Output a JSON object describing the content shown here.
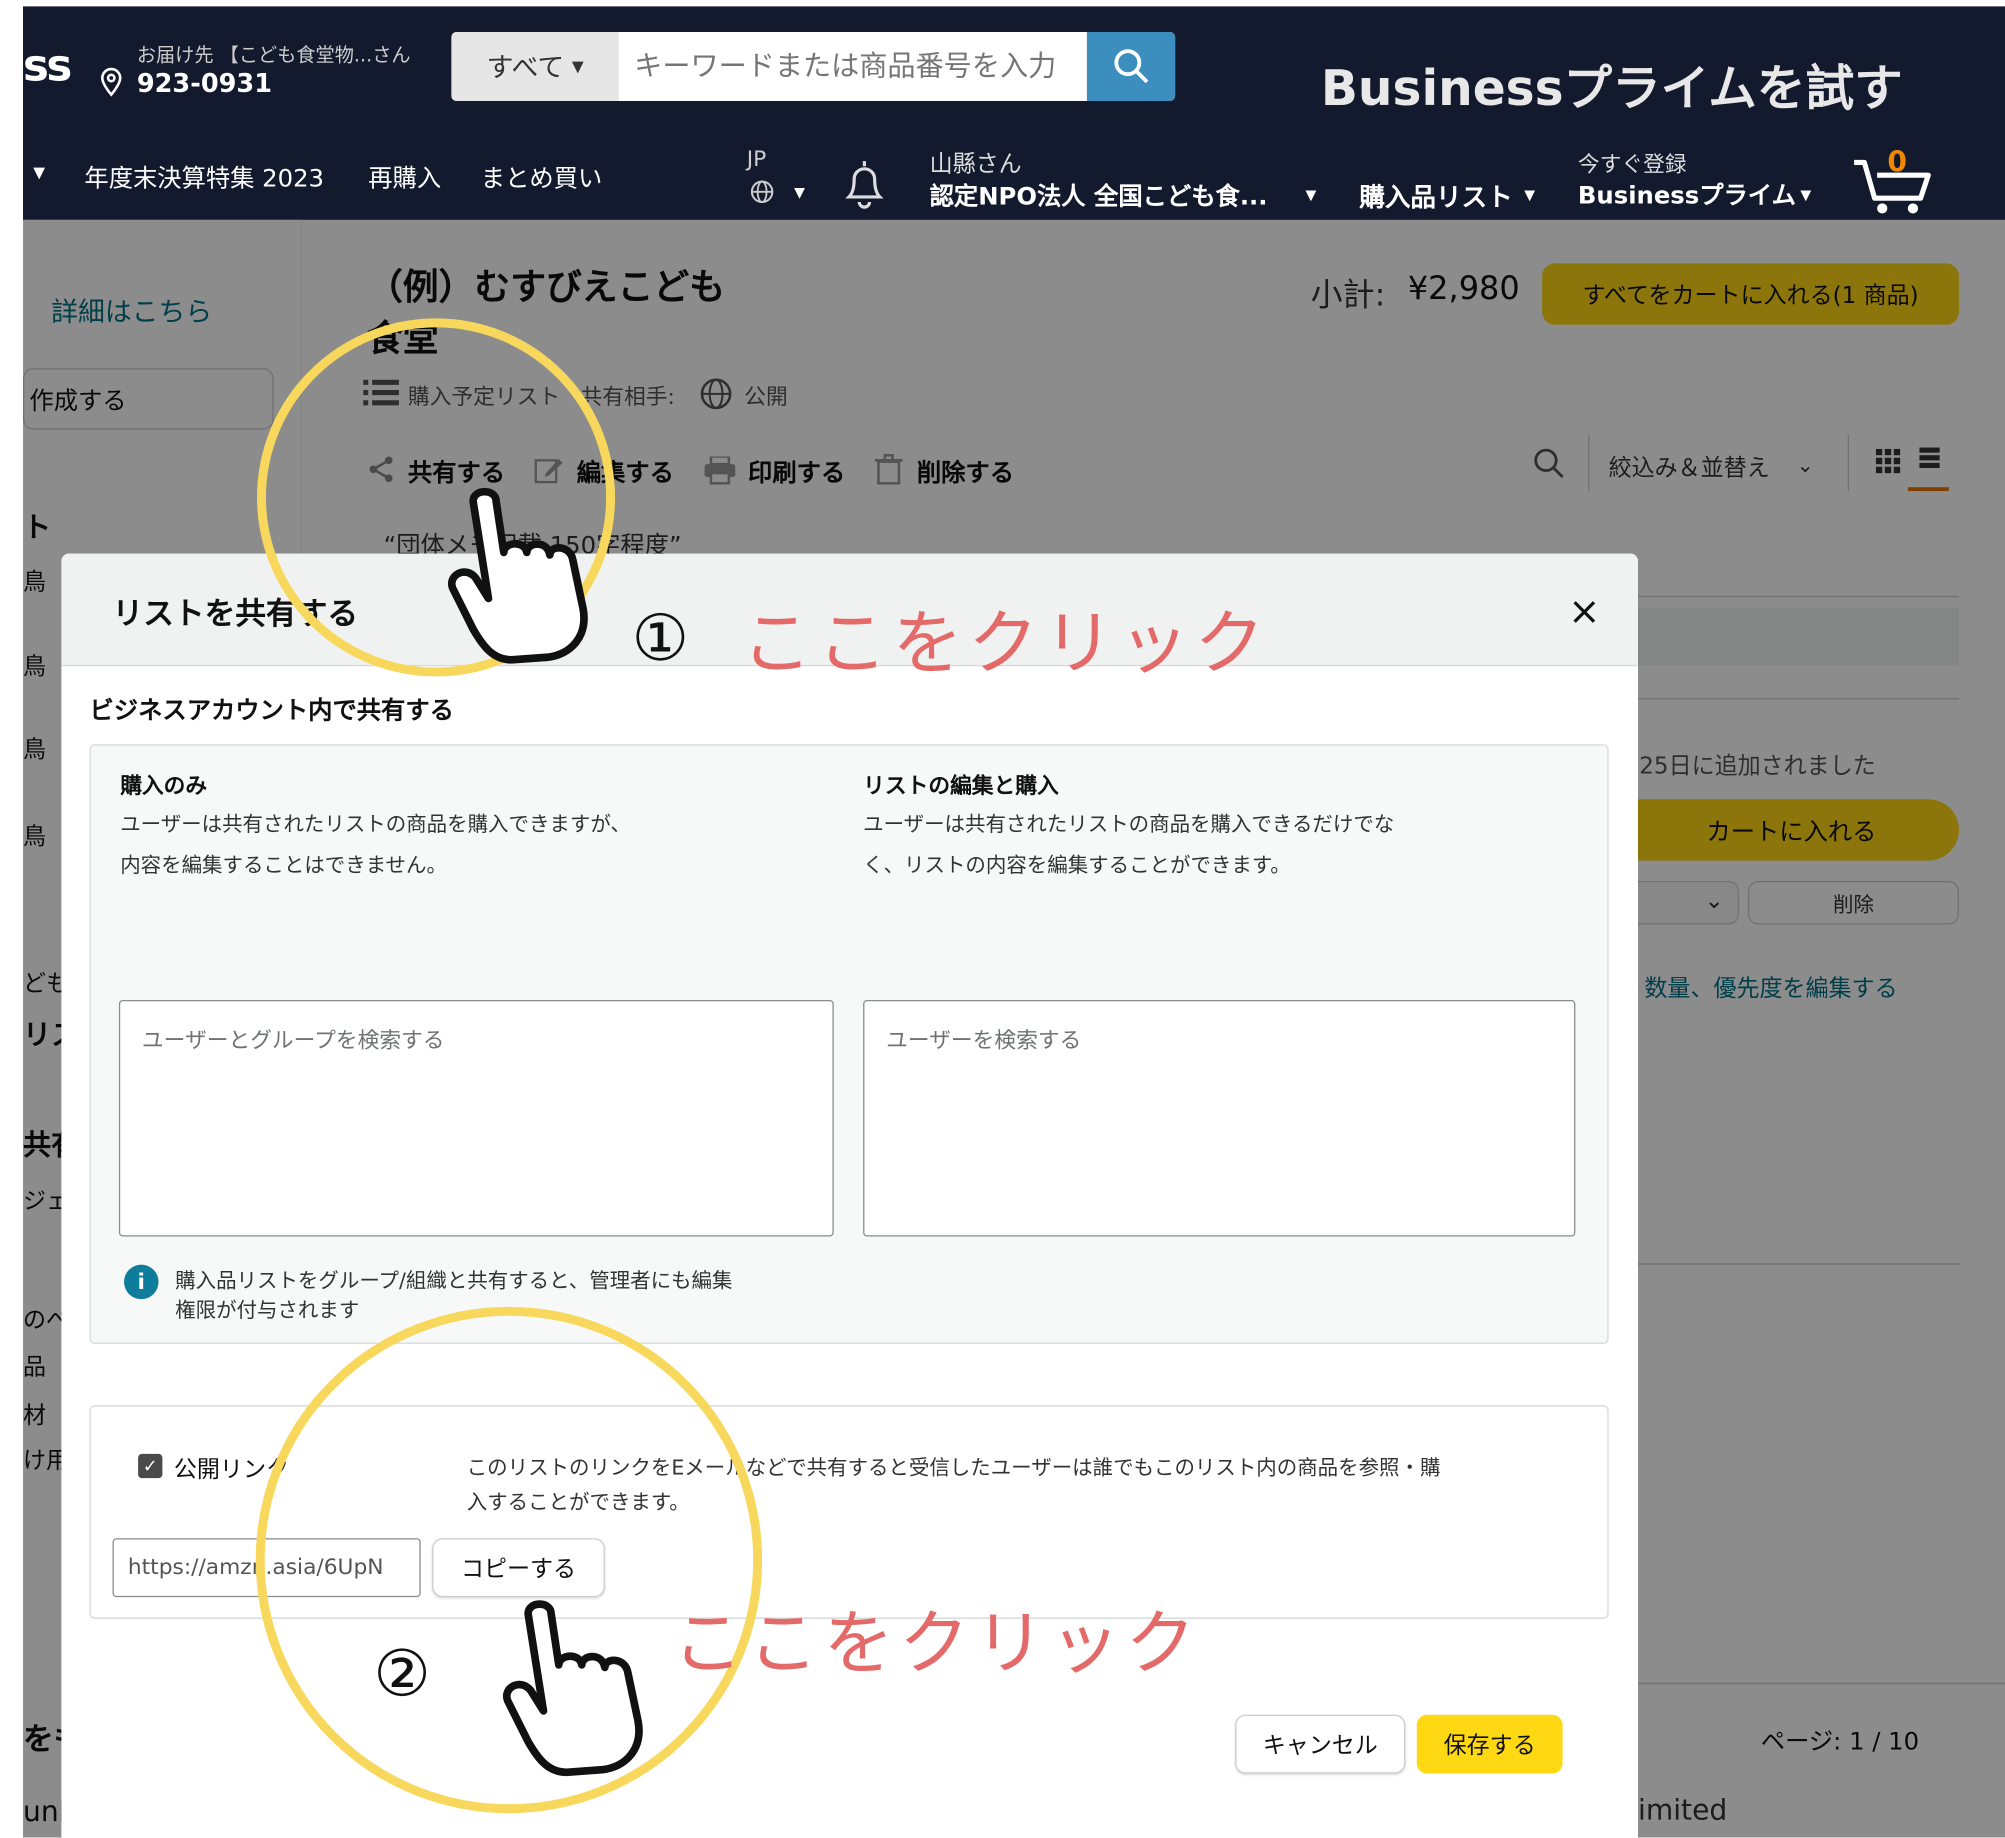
{
  "header": {
    "logo_fragment": "ss",
    "deliver_label": "お届け先 【こども食堂物...さん",
    "postal_code": "923-0931",
    "search_category": "すべて",
    "search_placeholder": "キーワードまたは商品番号を入力",
    "business_prime": "Businessプライムを試す"
  },
  "nav": {
    "items": [
      "年度末決算特集 2023",
      "再購入",
      "まとめ買い"
    ],
    "lang": "JP",
    "account_greeting": "山縣さん",
    "account_name": "認定NPO法人 全国こども食...",
    "lists": "購入品リスト",
    "prime_top": "今すぐ登録",
    "prime_bottom": "Businessプライム",
    "cart_count": "0"
  },
  "sidebar": {
    "details_link": "詳細はこちら",
    "create_button": "作成する",
    "fragments": [
      "ト",
      "鳥",
      "鳥",
      "鳥",
      "鳥",
      "ども",
      "リス",
      "共有",
      "ジェ",
      "のぺ",
      "品",
      "材",
      "け用",
      "をも",
      "unl"
    ]
  },
  "list": {
    "title": "（例）むすびえこども食堂",
    "subtotal_label": "小計:",
    "subtotal_value": "¥2,980",
    "add_all_button": "すべてをカートに入れる(1 商品)",
    "meta_type": "購入予定リスト",
    "meta_shared": "共有相手:",
    "meta_visibility": "公開",
    "action_share": "共有する",
    "action_edit": "編集する",
    "action_print": "印刷する",
    "action_delete": "削除する",
    "filter": "絞込み＆並替え",
    "description": "“団体メモ記載 150字程度”",
    "added_date": "25日に追加されました",
    "add_to_cart": "カートに入れる",
    "remove": "削除",
    "edit_link": "数量、優先度を編集する",
    "page_indicator": "ページ: 1 / 10",
    "footer_fragment": "imited"
  },
  "modal": {
    "title": "リストを共有する",
    "section_title": "ビジネスアカウント内で共有する",
    "buy_only_title": "購入のみ",
    "buy_only_desc_1": "ユーザーは共有されたリストの商品を購入できますが、",
    "buy_only_desc_2": "内容を編集することはできません。",
    "edit_buy_title": "リストの編集と購入",
    "edit_buy_desc_1": "ユーザーは共有されたリストの商品を購入できるだけでな",
    "edit_buy_desc_2": "く、リストの内容を編集することができます。",
    "search_users_groups": "ユーザーとグループを検索する",
    "search_users": "ユーザーを検索する",
    "info_1": "購入品リストをグループ/組織と共有すると、管理者にも編集",
    "info_2": "権限が付与されます",
    "public_link_label": "公開リンク",
    "public_link_desc_1": "このリストのリンクをEメールなどで共有すると受信したユーザーは誰でもこのリスト内の商品を参照・購",
    "public_link_desc_2": "入することができます。",
    "link_value": "https://amzn.asia/6UpN",
    "copy_button": "コピーする",
    "cancel_button": "キャンセル",
    "save_button": "保存する"
  },
  "annotations": {
    "step1_number": "①",
    "step1_text": "ここをクリック",
    "step2_number": "②",
    "step2_text": "ここをクリック"
  },
  "colors": {
    "header_bg": "#131a2e",
    "accent_yellow": "#ffd814",
    "annotation_circle": "#f8d85c",
    "annotation_text": "#e46a6a",
    "link_blue": "#007185"
  }
}
